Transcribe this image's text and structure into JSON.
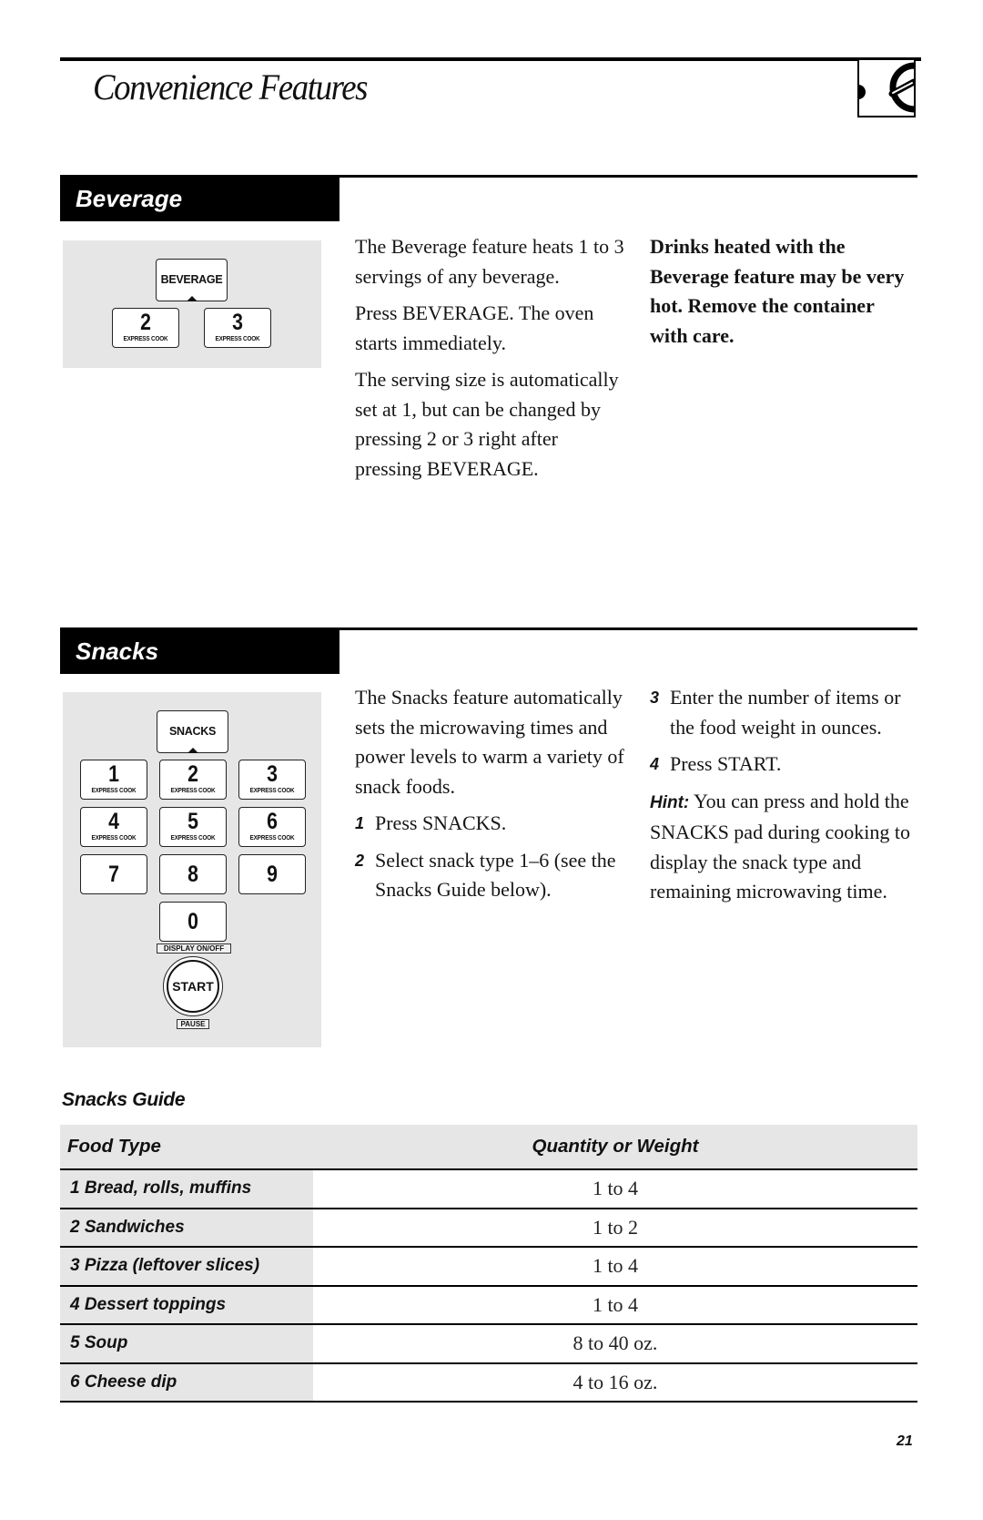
{
  "header": {
    "title": "Convenience Features",
    "icon": "oven-dial-icon"
  },
  "beverage": {
    "section_title": "Beverage",
    "keypad": {
      "main_key": "BEVERAGE",
      "keys": [
        {
          "num": "2",
          "sub": "EXPRESS COOK"
        },
        {
          "num": "3",
          "sub": "EXPRESS COOK"
        }
      ]
    },
    "paragraphs": [
      "The Beverage feature heats 1 to 3 servings of any beverage.",
      "Press BEVERAGE. The oven starts immediately.",
      "The serving size is automatically set at 1, but can be changed by pressing 2 or 3 right after pressing BEVERAGE."
    ],
    "warning": "Drinks heated with the Beverage feature may be very hot. Remove the container with care."
  },
  "snacks": {
    "section_title": "Snacks",
    "keypad": {
      "main_key": "SNACKS",
      "keys": [
        {
          "num": "1",
          "sub": "EXPRESS COOK"
        },
        {
          "num": "2",
          "sub": "EXPRESS COOK"
        },
        {
          "num": "3",
          "sub": "EXPRESS COOK"
        },
        {
          "num": "4",
          "sub": "EXPRESS COOK"
        },
        {
          "num": "5",
          "sub": "EXPRESS COOK"
        },
        {
          "num": "6",
          "sub": "EXPRESS COOK"
        },
        {
          "num": "7",
          "sub": ""
        },
        {
          "num": "8",
          "sub": ""
        },
        {
          "num": "9",
          "sub": ""
        },
        {
          "num": "0",
          "sub": ""
        }
      ],
      "zero_label": "DISPLAY ON/OFF",
      "start_key": "START",
      "start_label": "PAUSE"
    },
    "intro": "The Snacks feature automatically sets the microwaving times and power levels to warm a variety of snack foods.",
    "steps": [
      {
        "n": "1",
        "text": "Press SNACKS."
      },
      {
        "n": "2",
        "text": "Select snack type 1–6 (see the Snacks Guide below)."
      },
      {
        "n": "3",
        "text": "Enter the number of items or the food weight in ounces."
      },
      {
        "n": "4",
        "text": "Press START."
      }
    ],
    "hint_label": "Hint:",
    "hint_text": "You can press and hold the SNACKS pad during cooking to display the snack type and remaining microwaving time."
  },
  "guide": {
    "title": "Snacks Guide",
    "headers": [
      "Food Type",
      "Quantity or Weight"
    ],
    "rows": [
      {
        "food": "1 Bread, rolls, muffins",
        "qty": "1 to 4"
      },
      {
        "food": "2 Sandwiches",
        "qty": "1 to 2"
      },
      {
        "food": "3 Pizza (leftover slices)",
        "qty": "1 to 4"
      },
      {
        "food": "4 Dessert toppings",
        "qty": "1 to 4"
      },
      {
        "food": "5 Soup",
        "qty": "8 to 40 oz."
      },
      {
        "food": "6 Cheese dip",
        "qty": "4 to 16 oz."
      }
    ]
  },
  "page_number": "21"
}
